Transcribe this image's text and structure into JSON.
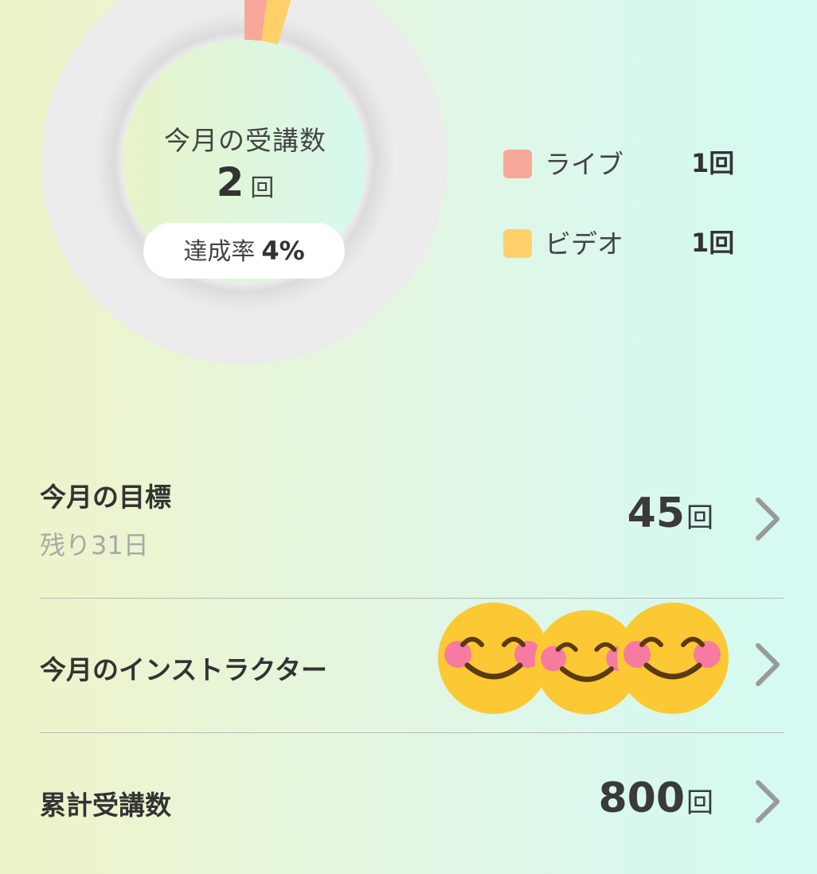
{
  "summary": {
    "title": "今月の受講数",
    "count": "2",
    "count_unit": "回",
    "rate_label": "達成率",
    "rate_value": "4%",
    "goal": 45,
    "colors": {
      "track": "#ececec",
      "live": "#f7a898",
      "video": "#fdd06a"
    },
    "legend": [
      {
        "label": "ライブ",
        "value": "1回",
        "count": 1,
        "color": "#f7a898"
      },
      {
        "label": "ビデオ",
        "value": "1回",
        "count": 1,
        "color": "#fdd06a"
      }
    ]
  },
  "goal_row": {
    "title": "今月の目標",
    "subtitle": "残り31日",
    "value": "45",
    "unit": "回",
    "icon": "chevron-right-icon"
  },
  "instructor_row": {
    "title": "今月のインストラクター",
    "avatars": [
      "smiling-face-icon",
      "smiling-face-icon",
      "smiling-face-icon"
    ],
    "icon": "chevron-right-icon"
  },
  "total_row": {
    "title": "累計受講数",
    "value": "800",
    "unit": "回",
    "icon": "chevron-right-icon"
  }
}
